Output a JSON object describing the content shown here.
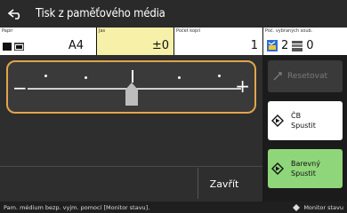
{
  "titlebar": {
    "title": "Tisk z paměťového média"
  },
  "settings": {
    "paper": {
      "label": "Papír",
      "value": "A4"
    },
    "density": {
      "label": "Jas",
      "value": "±0"
    },
    "copies": {
      "label": "Počet kopií",
      "value": "1"
    },
    "pages": {
      "label": "Poč. vybraných soub.",
      "selected": "2",
      "other": "0"
    }
  },
  "slider": {
    "minus": "−",
    "plus": "+",
    "level": 0
  },
  "actions": {
    "reset": "Resetovat",
    "bw_start": {
      "line1": "ČB",
      "line2": "Spustit"
    },
    "color_start": {
      "line1": "Barevný",
      "line2": "Spustit"
    },
    "close": "Zavřít"
  },
  "status": {
    "message": "Pam. médium bezp. vyjm. pomocí [Monitor stavu].",
    "monitor": "Monitor stavu"
  },
  "colors": {
    "accent": "#e2a54a",
    "density_bg": "#f7f0a8",
    "color_start_bg": "#8fd67a"
  }
}
